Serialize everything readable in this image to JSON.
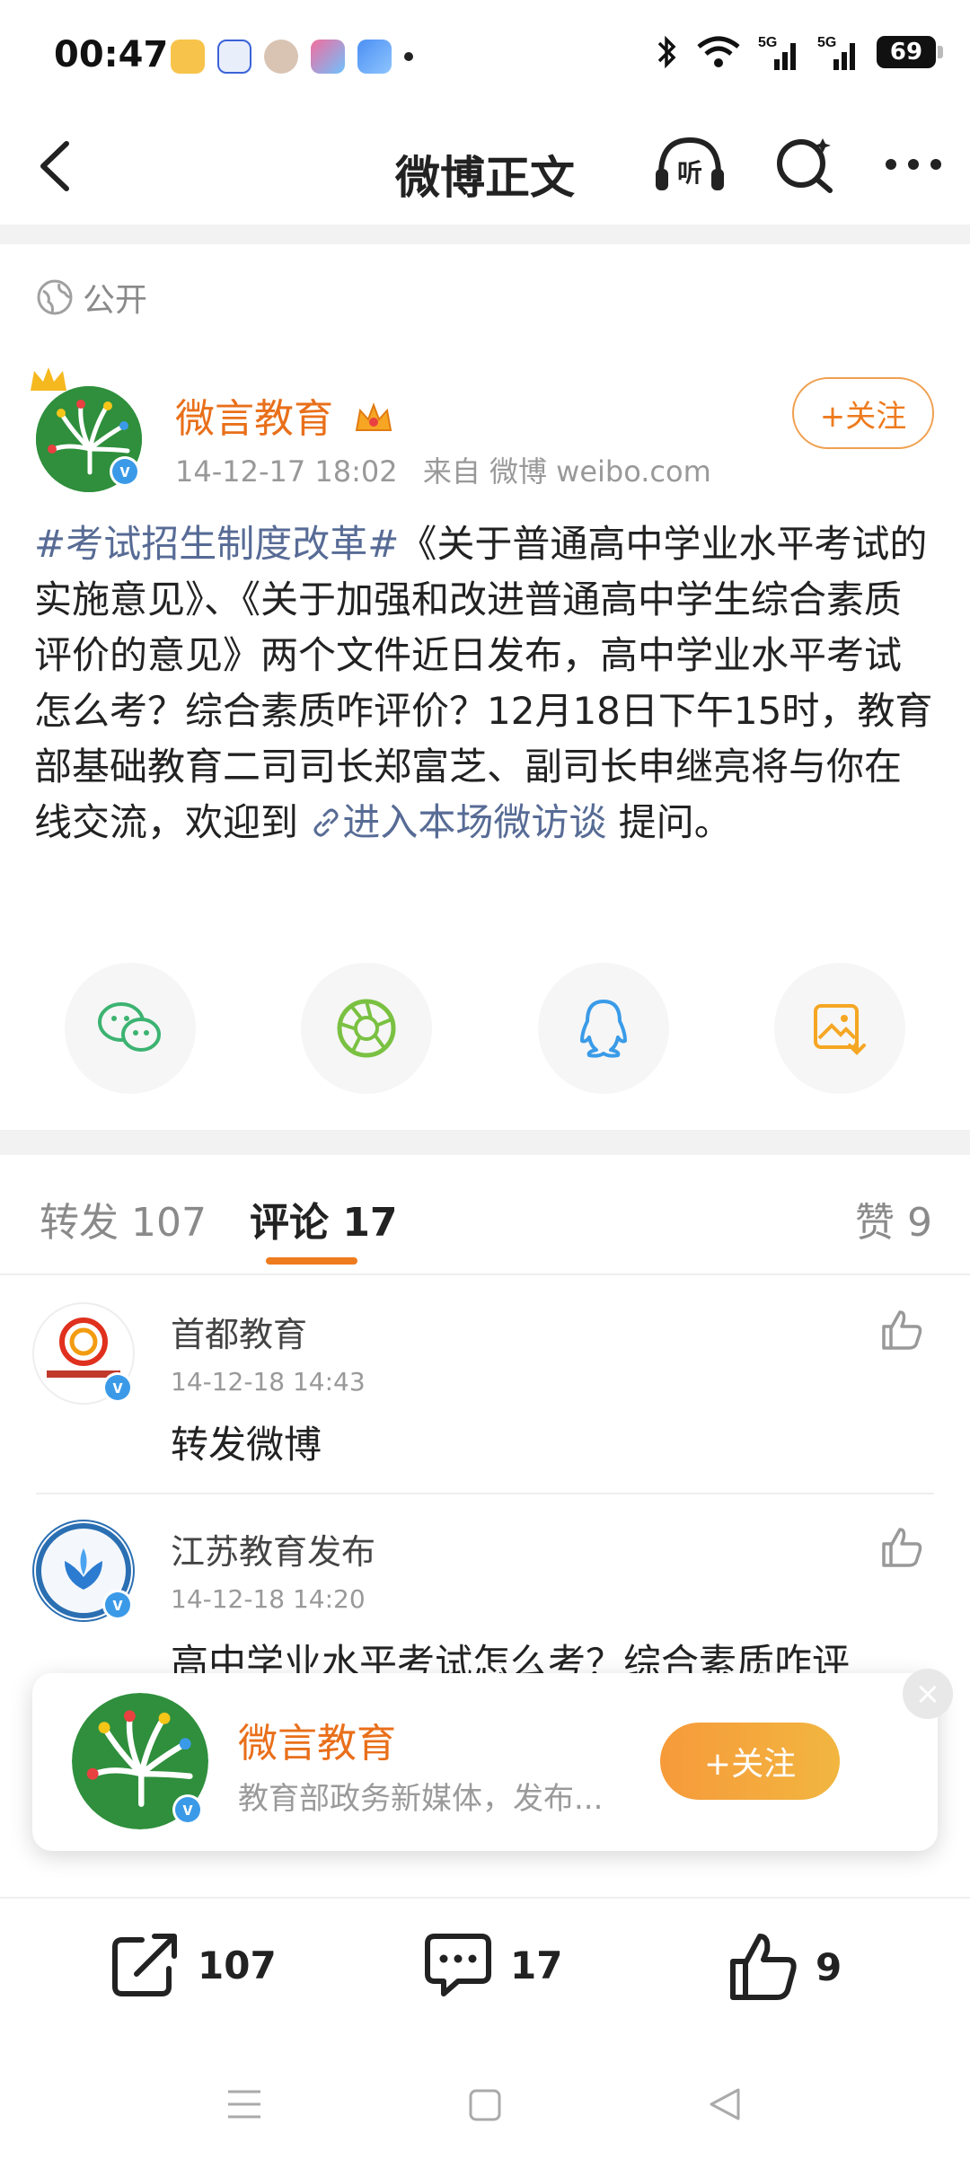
{
  "status_bar": {
    "time": "00:47",
    "battery": "69",
    "network": [
      "5G",
      "5G"
    ]
  },
  "header": {
    "title": "微博正文",
    "icons": [
      "back-icon",
      "listen-icon",
      "search-icon",
      "more-icon"
    ],
    "listen_label": "听"
  },
  "post": {
    "visibility": "公开",
    "author": "微言教育",
    "timestamp": "14-12-17 18:02",
    "source": "来自 微博 weibo.com",
    "follow_label": "+关注",
    "hashtag": "#考试招生制度改革#",
    "body": "《关于普通高中学业水平考试的实施意见》、《关于加强和改进普通高中学生综合素质评价的意见》两个文件近日发布，高中学业水平考试怎么考？综合素质咋评价？12月18日下午15时，教育部基础教育二司司长郑富芝、副司长申继亮将与你在线交流，欢迎到",
    "link_text": "进入本场微访谈",
    "body_tail": " 提问。",
    "share_targets": [
      "wechat-icon",
      "moments-icon",
      "qq-icon",
      "save-image-icon"
    ]
  },
  "tabs": {
    "repost": "转发 107",
    "comments": "评论 17",
    "likes": "赞 9"
  },
  "comments": [
    {
      "name": "首都教育",
      "time": "14-12-18 14:43",
      "text": "转发微博"
    },
    {
      "name": "江苏教育发布",
      "time": "14-12-18 14:20",
      "text": "高中学业水平考试怎么考？综合素质咋评"
    }
  ],
  "popup": {
    "name": "微言教育",
    "desc": "教育部政务新媒体，发布...",
    "follow_label": "+关注",
    "close": "×"
  },
  "bottom_bar": {
    "repost_count": "107",
    "comment_count": "17",
    "like_count": "9"
  },
  "colors": {
    "accent": "#ee7b1e",
    "link": "#576b95",
    "verified": "#3b9ae8"
  }
}
